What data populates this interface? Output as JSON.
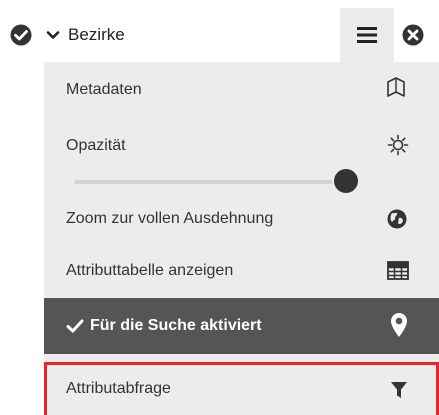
{
  "layer": {
    "name": "Bezirke",
    "checked": true
  },
  "menu": {
    "items": [
      {
        "label": "Metadaten",
        "icon": "map-pages-icon"
      },
      {
        "label": "Opazität",
        "icon": "brightness-icon"
      },
      {
        "label": "Zoom zur vollen Ausdehnung",
        "icon": "globe-icon"
      },
      {
        "label": "Attributtabelle anzeigen",
        "icon": "table-icon"
      },
      {
        "label": "Für die Suche aktiviert",
        "icon": "map-marker-icon",
        "checked": true
      },
      {
        "label": "Attributabfrage",
        "icon": "filter-icon"
      }
    ],
    "opacity": 1.0
  },
  "colors": {
    "panel": "#ececec",
    "active_row": "#555555",
    "highlight_border": "#e8232a"
  }
}
